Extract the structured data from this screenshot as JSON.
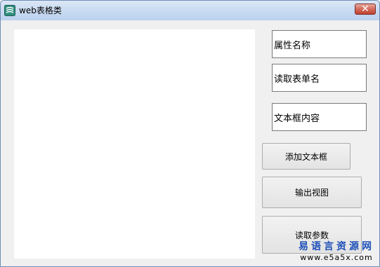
{
  "window": {
    "title": "web表格类",
    "close_label": "✕"
  },
  "fields": {
    "property_name": "属性名称",
    "read_form_name": "读取表单名",
    "textbox_content": "文本框内容"
  },
  "buttons": {
    "add_textbox": "添加文本框",
    "output_view": "输出视图",
    "read_params": "读取参数"
  },
  "watermark": {
    "site_name": "易语言资源网",
    "domain": "www.e5a5x.com"
  },
  "colors": {
    "title_bar": "#c8daf1",
    "close_button": "#c1412f",
    "watermark_text": "#1d4fb8"
  }
}
